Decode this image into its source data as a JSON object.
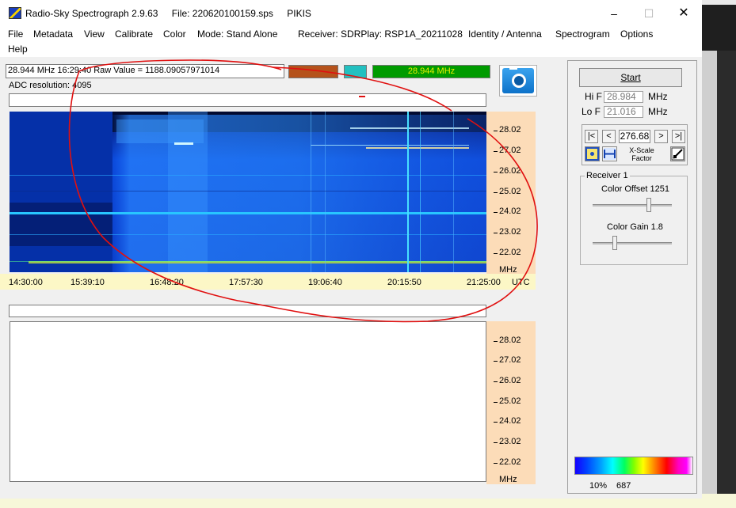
{
  "window": {
    "app_title": "Radio-Sky Spectrograph 2.9.63",
    "file_label": "File: 220620100159.sps",
    "site": "PIKIS",
    "controls": {
      "minimize": "–",
      "maximize": "☐",
      "close": "✕"
    }
  },
  "menu": {
    "file": "File",
    "metadata": "Metadata",
    "view": "View",
    "calibrate": "Calibrate",
    "color": "Color",
    "mode": "Mode: Stand Alone",
    "receiver": "Receiver:  SDRPlay: RSP1A_20211028",
    "identity": "Identity / Antenna",
    "spectrogram": "Spectrogram",
    "options": "Options",
    "help": "Help"
  },
  "readout": {
    "text": "28.944 MHz  16:29:40  Raw Value =  1188.09057971014",
    "frequency_box": "28.944 MHz",
    "adc_label": "ADC resolution:  4095"
  },
  "spectrogram": {
    "freq_ticks": [
      "28.02",
      "27.02",
      "26.02",
      "25.02",
      "24.02",
      "23.02",
      "22.02"
    ],
    "freq_unit": "MHz",
    "time_ticks": [
      "14:30:00",
      "15:39:10",
      "16:48:20",
      "17:57:30",
      "19:06:40",
      "20:15:50",
      "21:25:00"
    ],
    "time_unit": "UTC"
  },
  "lower_plot": {
    "freq_ticks": [
      "28.02",
      "27.02",
      "26.02",
      "25.02",
      "24.02",
      "23.02",
      "22.02"
    ],
    "freq_unit": "MHz"
  },
  "controls": {
    "start_label": "Start",
    "hi_f_label": "Hi F",
    "hi_f_value": "28.984",
    "lo_f_label": "Lo F",
    "lo_f_value": "21.016",
    "mhz_unit": "MHz",
    "nav_first": "|<",
    "nav_prev": "<",
    "xscale_value": "276.68",
    "nav_next": ">",
    "nav_last": ">|",
    "xscale_label": "X-Scale Factor",
    "receiver_group": "Receiver 1",
    "color_offset_label": "Color Offset 1251",
    "color_offset_level": 0.72,
    "color_gain_label": "Color Gain 1.8",
    "color_gain_level": 0.27,
    "colorbar_pct": "10%",
    "colorbar_value": "687"
  },
  "colors": {
    "swatch_a": "#b5521b",
    "swatch_b": "#22c0c0",
    "freq_box_bg": "#009b00",
    "annotation_red": "#e01010"
  }
}
